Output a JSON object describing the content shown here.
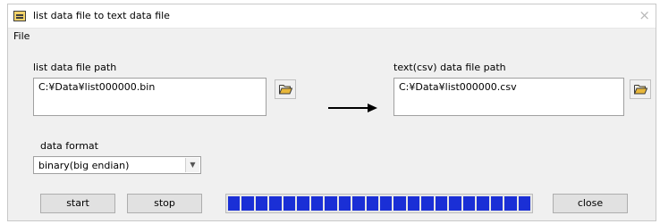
{
  "window": {
    "title": "list data file to text data file",
    "close_glyph": "×"
  },
  "menu": {
    "file_label": "File"
  },
  "source": {
    "label": "list data file path",
    "value": "C:¥Data¥list000000.bin",
    "browse_icon": "folder-open-icon"
  },
  "dest": {
    "label": "text(csv) data file path",
    "value": "C:¥Data¥list000000.csv",
    "browse_icon": "folder-open-icon"
  },
  "format": {
    "label": "data format",
    "selected": "binary(big endian)"
  },
  "buttons": {
    "start": "start",
    "stop": "stop",
    "close": "close"
  },
  "progress": {
    "fraction": 1.0,
    "color": "#1a2fd6",
    "segments": 22
  }
}
